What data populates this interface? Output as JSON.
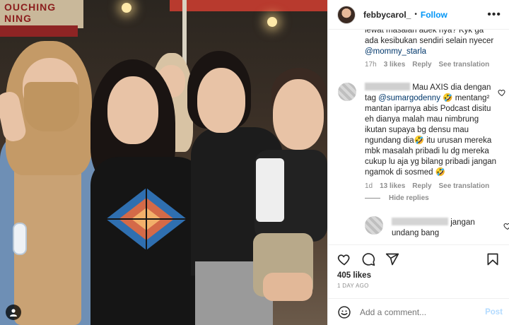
{
  "header": {
    "username": "febbycarol_",
    "separator": "•",
    "follow_label": "Follow",
    "more_icon": "more-horizontal-icon"
  },
  "comments": {
    "top_comment": {
      "text": "lewat masalah adek nya? Kyk ga ada kesibukan sendiri selain nyecer",
      "mention": "@mommy_starla",
      "time": "17h",
      "likes": "3 likes",
      "reply": "Reply",
      "translate": "See translation"
    },
    "main_comment": {
      "text_1": "Mau AXIS dia dengan tag",
      "mention": "@sumargodenny",
      "emoji_1": "🤣",
      "text_2": "mentang² mantan iparnya abis Podcast disitu eh dianya malah mau nimbrung ikutan supaya bg densu mau ngundang dia",
      "emoji_2": "🤣",
      "text_3": "itu urusan mereka mbk masalah pribadi lu dg mereka cukup lu aja yg bilang pribadi jangan ngamok di sosmed",
      "emoji_3": "🤣",
      "time": "1d",
      "likes": "13 likes",
      "reply": "Reply",
      "translate": "See translation"
    },
    "hide_replies_label": "Hide replies",
    "reply_comment": {
      "text": "jangan undang bang"
    }
  },
  "actions": {
    "likes": "405 likes",
    "time_ago": "1 DAY AGO"
  },
  "add_comment": {
    "placeholder": "Add a comment...",
    "post_label": "Post"
  },
  "photo": {
    "sign_text": "OUCHING\nNING"
  },
  "colors": {
    "accent": "#0095f6",
    "mention": "#00376b",
    "muted": "#8e8e8e",
    "post_disabled": "#b3dbff"
  }
}
